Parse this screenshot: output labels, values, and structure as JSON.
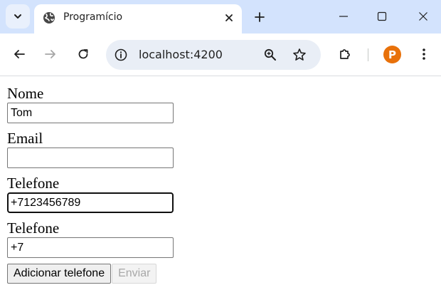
{
  "browser": {
    "tab": {
      "title": "Programício"
    },
    "address_bar": {
      "url": "localhost:4200"
    },
    "profile_initial": "P",
    "colors": {
      "tabstrip": "#d3e3fd",
      "omnibox": "#e9eef6",
      "avatar": "#e8710a"
    }
  },
  "form": {
    "fields": [
      {
        "label": "Nome",
        "value": "Tom"
      },
      {
        "label": "Email",
        "value": ""
      },
      {
        "label": "Telefone",
        "value": "+7123456789"
      },
      {
        "label": "Telefone",
        "value": "+7"
      }
    ],
    "buttons": {
      "add_phone": "Adicionar telefone",
      "submit": "Enviar"
    }
  }
}
